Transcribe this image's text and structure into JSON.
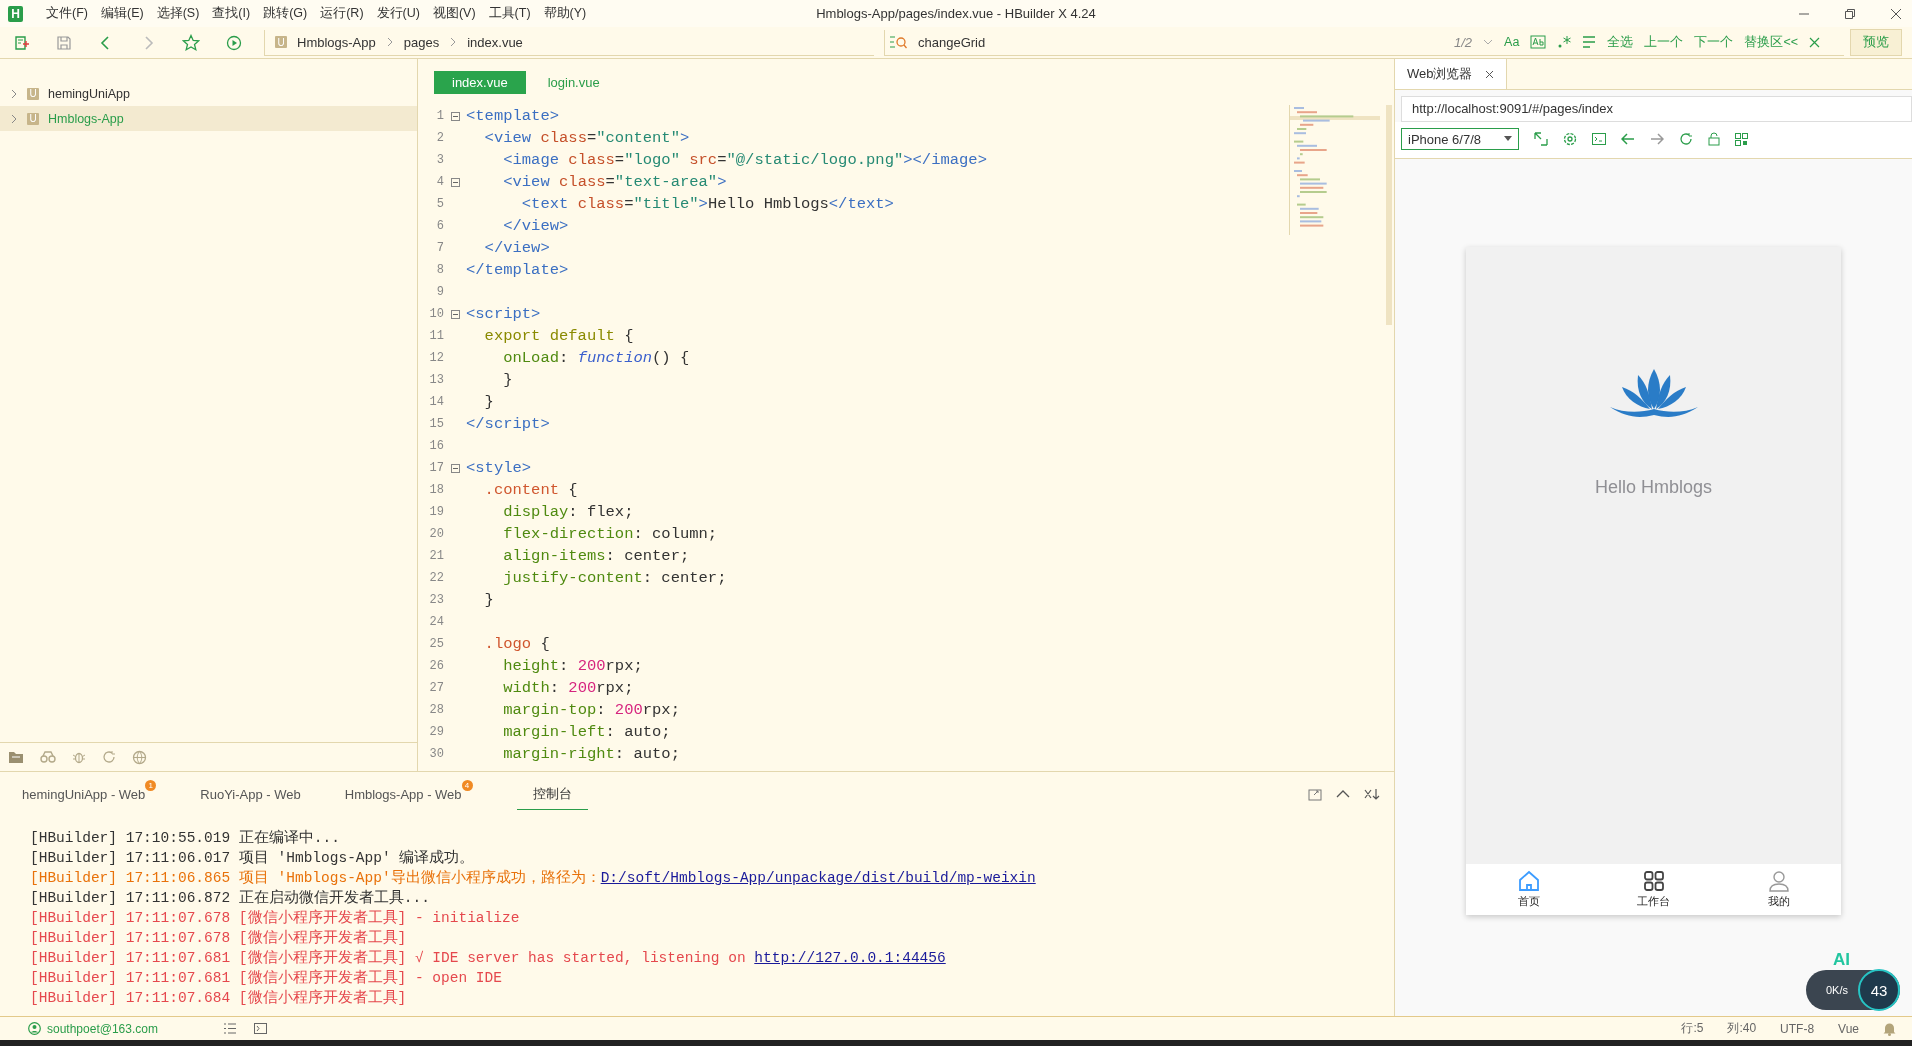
{
  "window": {
    "logo": "H",
    "title": "Hmblogs-App/pages/index.vue - HBuilder X 4.24"
  },
  "menu": [
    "文件(F)",
    "编辑(E)",
    "选择(S)",
    "查找(I)",
    "跳转(G)",
    "运行(R)",
    "发行(U)",
    "视图(V)",
    "工具(T)",
    "帮助(Y)"
  ],
  "breadcrumb": {
    "project_badge": "U",
    "parts": [
      "Hmblogs-App",
      "pages",
      "index.vue"
    ]
  },
  "search": {
    "value": "changeGrid",
    "count": "1/2",
    "case_label": "Aa",
    "actions": [
      "全选",
      "上一个",
      "下一个",
      "替换区<<"
    ],
    "preview_button": "预览"
  },
  "project_tree": [
    {
      "badge": "U",
      "name": "hemingUniApp",
      "selected": false,
      "expanded": false
    },
    {
      "badge": "U",
      "name": "Hmblogs-App",
      "selected": true,
      "expanded": false
    }
  ],
  "editor": {
    "tabs": [
      {
        "label": "index.vue",
        "selected": true
      },
      {
        "label": "login.vue",
        "selected": false
      }
    ],
    "lines": [
      {
        "n": "1",
        "fold": true,
        "code": "<template>"
      },
      {
        "n": "2",
        "fold": false,
        "code": "  <view class=\"content\">"
      },
      {
        "n": "3",
        "fold": false,
        "code": "    <image class=\"logo\" src=\"@/static/logo.png\"></image>"
      },
      {
        "n": "4",
        "fold": true,
        "code": "    <view class=\"text-area\">"
      },
      {
        "n": "5",
        "fold": false,
        "code": "      <text class=\"title\">Hello Hmblogs</text>"
      },
      {
        "n": "6",
        "fold": false,
        "code": "    </view>"
      },
      {
        "n": "7",
        "fold": false,
        "code": "  </view>"
      },
      {
        "n": "8",
        "fold": false,
        "code": "</template>"
      },
      {
        "n": "9",
        "fold": false
      },
      {
        "n": "10",
        "fold": true,
        "code": "<script>"
      },
      {
        "n": "11",
        "fold": false,
        "code": "  export default {"
      },
      {
        "n": "12",
        "fold": false,
        "code": "    onLoad: function() {"
      },
      {
        "n": "13",
        "fold": false,
        "code": "    }"
      },
      {
        "n": "14",
        "fold": false,
        "code": "  }"
      },
      {
        "n": "15",
        "fold": false,
        "code": "</script>"
      },
      {
        "n": "16",
        "fold": false
      },
      {
        "n": "17",
        "fold": true,
        "code": "<style>"
      },
      {
        "n": "18",
        "fold": false,
        "code": "  .content {"
      },
      {
        "n": "19",
        "fold": false,
        "code": "    display: flex;"
      },
      {
        "n": "20",
        "fold": false,
        "code": "    flex-direction: column;"
      },
      {
        "n": "21",
        "fold": false,
        "code": "    align-items: center;"
      },
      {
        "n": "22",
        "fold": false,
        "code": "    justify-content: center;"
      },
      {
        "n": "23",
        "fold": false,
        "code": "  }"
      },
      {
        "n": "24",
        "fold": false
      },
      {
        "n": "25",
        "fold": false,
        "code": "  .logo {"
      },
      {
        "n": "26",
        "fold": false,
        "code": "    height: 200rpx;"
      },
      {
        "n": "27",
        "fold": false,
        "code": "    width: 200rpx;"
      },
      {
        "n": "28",
        "fold": false,
        "code": "    margin-top: 200rpx;"
      },
      {
        "n": "29",
        "fold": false,
        "code": "    margin-left: auto;"
      },
      {
        "n": "30",
        "fold": false,
        "code": "    margin-right: auto;"
      }
    ]
  },
  "browser": {
    "tab": "Web浏览器",
    "url": "http://localhost:9091/#/pages/index",
    "device": "iPhone 6/7/8",
    "page": {
      "title": "Hello Hmblogs",
      "tabbar": [
        {
          "label": "首页",
          "selected": true
        },
        {
          "label": "工作台",
          "selected": false
        },
        {
          "label": "我的",
          "selected": false
        }
      ]
    }
  },
  "console": {
    "tabs": [
      {
        "label": "hemingUniApp - Web",
        "badge": "1",
        "selected": false
      },
      {
        "label": "RuoYi-App - Web",
        "selected": false
      },
      {
        "label": "Hmblogs-App - Web",
        "badge": "4",
        "selected": false
      },
      {
        "label": "控制台",
        "selected": true
      }
    ],
    "lines": [
      {
        "kind": "info",
        "source": "[HBuilder]",
        "time": "17:10:55.019",
        "text": "正在编译中..."
      },
      {
        "kind": "info",
        "source": "[HBuilder]",
        "time": "17:11:06.017",
        "text": "项目 'Hmblogs-App' 编译成功。"
      },
      {
        "kind": "warn",
        "source": "[HBuilder]",
        "time": "17:11:06.865",
        "text": "项目 'Hmblogs-App'导出微信小程序成功，路径为：",
        "link": "D:/soft/Hmblogs-App/unpackage/dist/build/mp-weixin"
      },
      {
        "kind": "info",
        "source": "[HBuilder]",
        "time": "17:11:06.872",
        "text": "正在启动微信开发者工具..."
      },
      {
        "kind": "error",
        "source": "[HBuilder]",
        "time": "17:11:07.678",
        "text": "[微信小程序开发者工具] - initialize"
      },
      {
        "kind": "error",
        "source": "[HBuilder]",
        "time": "17:11:07.678",
        "text": "[微信小程序开发者工具]"
      },
      {
        "kind": "error",
        "source": "[HBuilder]",
        "time": "17:11:07.681",
        "text": "[微信小程序开发者工具] √ IDE server has started, listening on ",
        "link": "http://127.0.0.1:44456"
      },
      {
        "kind": "error",
        "source": "[HBuilder]",
        "time": "17:11:07.681",
        "text": "[微信小程序开发者工具] - open IDE"
      },
      {
        "kind": "error",
        "source": "[HBuilder]",
        "time": "17:11:07.684",
        "text": "[微信小程序开发者工具]"
      }
    ]
  },
  "status_bar": {
    "user": "southpoet@163.com",
    "line": "行:5",
    "column": "列:40",
    "encoding": "UTF-8",
    "language": "Vue"
  },
  "network_widget": {
    "label": "AI",
    "speed": "0K/s",
    "load": "43"
  }
}
